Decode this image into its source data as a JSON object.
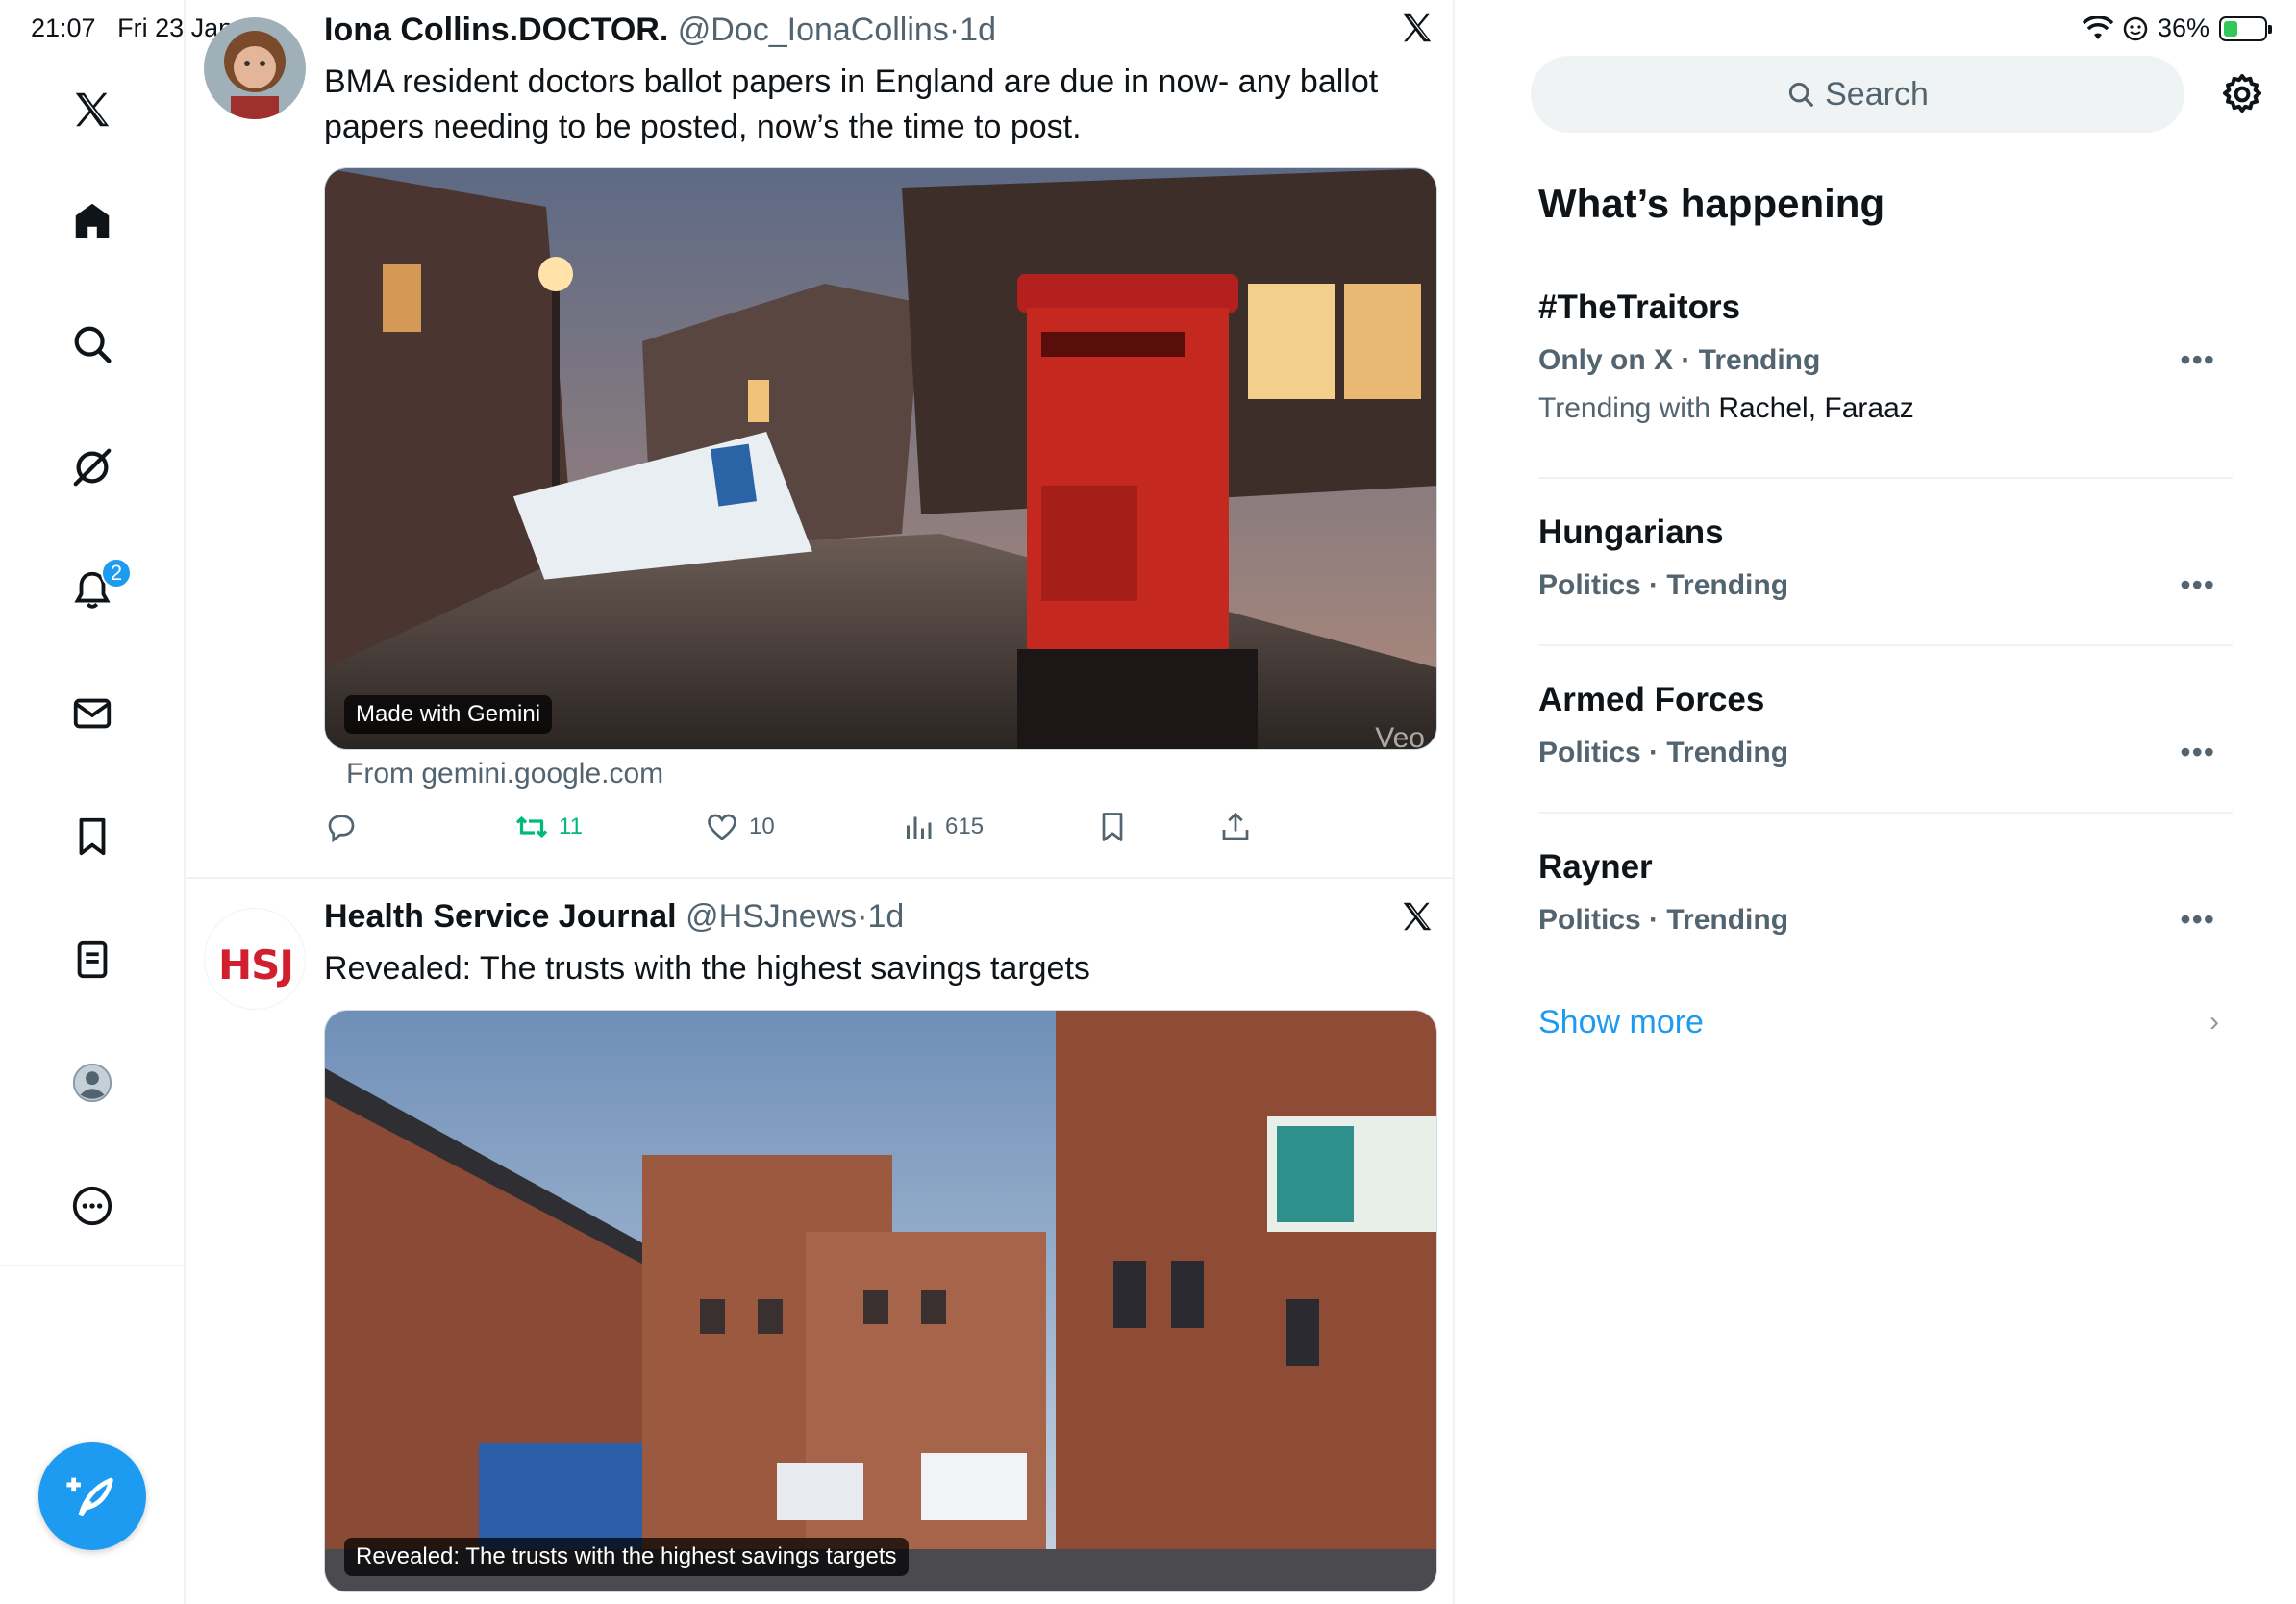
{
  "status_bar": {
    "time": "21:07",
    "date": "Fri 23 Jan",
    "battery": "36%",
    "battery_level": 0.36
  },
  "nav": {
    "items": [
      "x-logo-icon",
      "home-icon",
      "search-icon",
      "grok-icon",
      "notifications-icon",
      "messages-icon",
      "bookmarks-icon",
      "lists-icon",
      "profile-icon",
      "more-icon"
    ],
    "notification_count": "2"
  },
  "posts": [
    {
      "name": "Iona Collins.DOCTOR.",
      "handle": "@Doc_IonaCollins",
      "separator": "·",
      "time": "1d",
      "text": "BMA resident doctors ballot papers in England are due in now- any ballot papers needing to be posted, now’s the time to post.",
      "media_caption": "Made with Gemini",
      "media_watermark": "Veo",
      "source": "From gemini.google.com",
      "actions": {
        "replies": "",
        "reposts": "11",
        "likes": "10",
        "views": "615"
      }
    },
    {
      "name": "Health Service Journal",
      "handle": "@HSJnews",
      "separator": "·",
      "time": "1d",
      "text": "Revealed: The trusts with the highest savings targets",
      "avatar_text": "HSJ",
      "media_caption": "Revealed: The trusts with the highest savings targets"
    }
  ],
  "sidebar": {
    "search_placeholder": "Search",
    "section_title": "What’s happening",
    "trends": [
      {
        "name": "#TheTraitors",
        "meta": "Only on X · Trending",
        "with_label": "Trending with",
        "with_names": "Rachel, Faraaz"
      },
      {
        "name": "Hungarians",
        "meta": "Politics · Trending"
      },
      {
        "name": "Armed Forces",
        "meta": "Politics · Trending"
      },
      {
        "name": "Rayner",
        "meta": "Politics · Trending"
      }
    ],
    "show_more": "Show more"
  },
  "colors": {
    "accent": "#1d9bf0",
    "repost_green": "#00ba7c",
    "secondary_text": "#536471",
    "divider": "#eff3f4"
  }
}
